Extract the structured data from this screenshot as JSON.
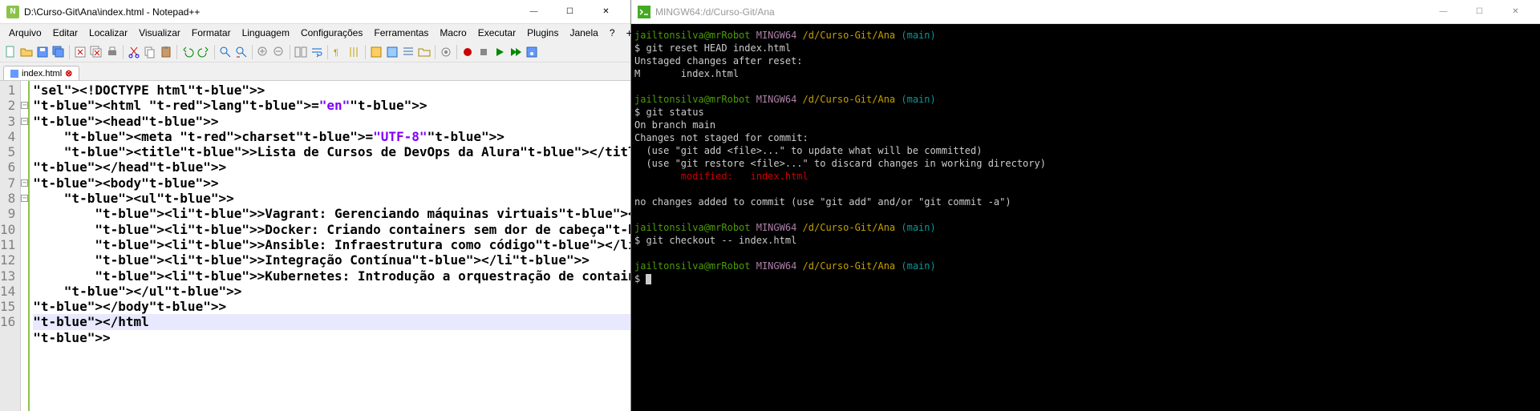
{
  "notepad": {
    "title": "D:\\Curso-Git\\Ana\\index.html - Notepad++",
    "menu": [
      "Arquivo",
      "Editar",
      "Localizar",
      "Visualizar",
      "Formatar",
      "Linguagem",
      "Configurações",
      "Ferramentas",
      "Macro",
      "Executar",
      "Plugins",
      "Janela",
      "?"
    ],
    "tab": {
      "label": "index.html"
    },
    "lines": [
      {
        "n": 1,
        "raw": "<!DOCTYPE html>"
      },
      {
        "n": 2,
        "raw": "<html lang=\"en\">"
      },
      {
        "n": 3,
        "raw": "<head>"
      },
      {
        "n": 4,
        "raw": "    <meta charset=\"UTF-8\">"
      },
      {
        "n": 5,
        "raw": "    <title>Lista de Cursos de DevOps da Alura</title>"
      },
      {
        "n": 6,
        "raw": "</head>"
      },
      {
        "n": 7,
        "raw": "<body>"
      },
      {
        "n": 8,
        "raw": "    <ul>"
      },
      {
        "n": 9,
        "raw": "        <li>Vagrant: Gerenciando máquinas virtuais</li>"
      },
      {
        "n": 10,
        "raw": "        <li>Docker: Criando containers sem dor de cabeça</li>"
      },
      {
        "n": 11,
        "raw": "        <li>Ansible: Infraestrutura como código</li>"
      },
      {
        "n": 12,
        "raw": "        <li>Integração Contínua</li>"
      },
      {
        "n": 13,
        "raw": "        <li>Kubernetes: Introdução a orquestração de containers</"
      },
      {
        "n": 14,
        "raw": "    </ul>"
      },
      {
        "n": 15,
        "raw": "</body>"
      },
      {
        "n": 16,
        "raw": "</html>"
      }
    ]
  },
  "terminal": {
    "title": "MINGW64:/d/Curso-Git/Ana",
    "prompt": {
      "user": "jailtonsilva@mrRobot",
      "sys": "MINGW64",
      "path": "/d/Curso-Git/Ana",
      "branch": "(main)"
    },
    "lines": [
      {
        "type": "prompt"
      },
      {
        "type": "cmd",
        "text": "$ git reset HEAD index.html"
      },
      {
        "type": "out",
        "text": "Unstaged changes after reset:"
      },
      {
        "type": "out",
        "text": "M       index.html"
      },
      {
        "type": "blank"
      },
      {
        "type": "prompt"
      },
      {
        "type": "cmd",
        "text": "$ git status"
      },
      {
        "type": "out",
        "text": "On branch main"
      },
      {
        "type": "out",
        "text": "Changes not staged for commit:"
      },
      {
        "type": "out",
        "text": "  (use \"git add <file>...\" to update what will be committed)"
      },
      {
        "type": "out",
        "text": "  (use \"git restore <file>...\" to discard changes in working directory)"
      },
      {
        "type": "mod",
        "text": "        modified:   index.html"
      },
      {
        "type": "blank"
      },
      {
        "type": "out",
        "text": "no changes added to commit (use \"git add\" and/or \"git commit -a\")"
      },
      {
        "type": "blank"
      },
      {
        "type": "prompt"
      },
      {
        "type": "cmd",
        "text": "$ git checkout -- index.html"
      },
      {
        "type": "blank"
      },
      {
        "type": "prompt"
      },
      {
        "type": "cursor",
        "text": "$ "
      }
    ]
  }
}
